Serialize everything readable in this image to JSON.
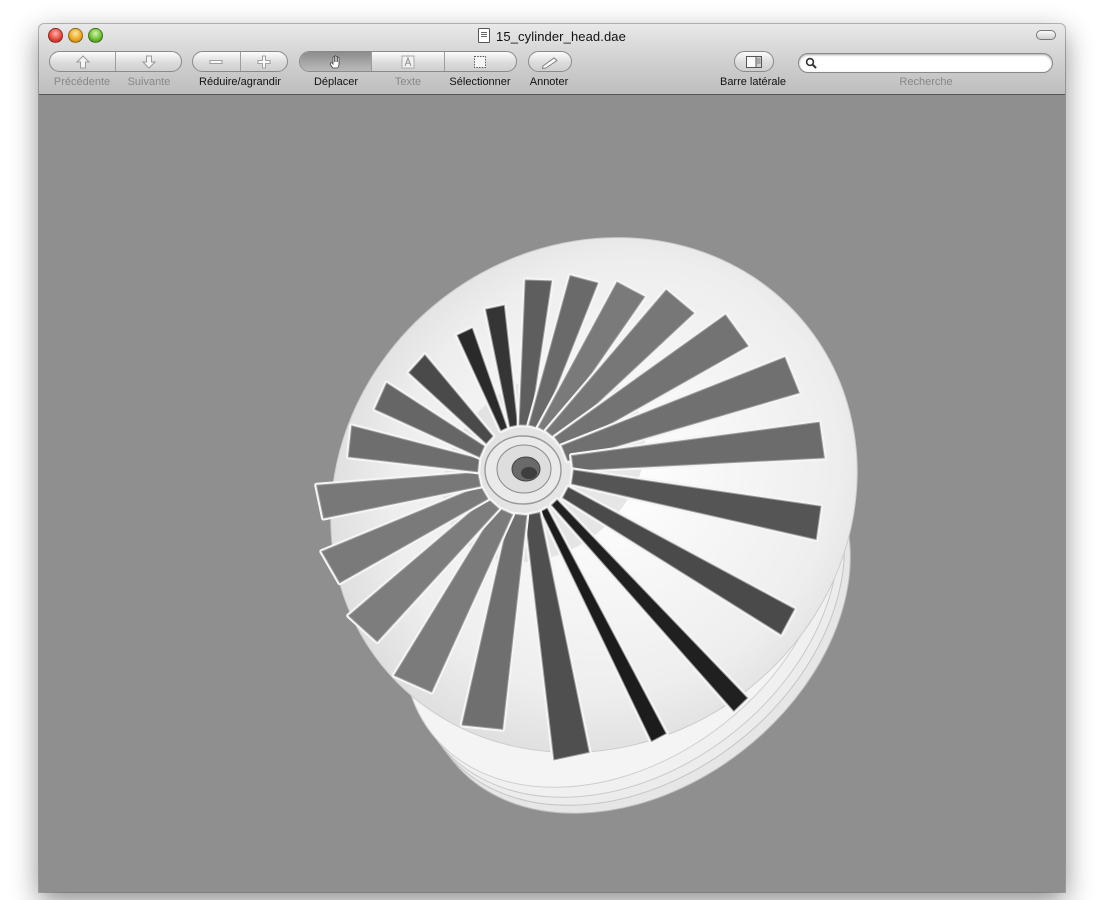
{
  "window": {
    "title": "15_cylinder_head.dae"
  },
  "toolbar": {
    "previous_label": "Précédente",
    "next_label": "Suivante",
    "zoom_label": "Réduire/agrandir",
    "move_label": "Déplacer",
    "text_label": "Texte",
    "select_label": "Sélectionner",
    "annotate_label": "Annoter",
    "sidebar_label": "Barre latérale",
    "search_label": "Recherche",
    "search_value": "",
    "search_placeholder": "",
    "active_tool": "Déplacer"
  },
  "icons": {
    "previous": "arrow-up-icon",
    "next": "arrow-down-icon",
    "zoom_out": "minus-icon",
    "zoom_in": "plus-icon",
    "move": "hand-icon",
    "text": "text-cursor-icon",
    "select": "marquee-icon",
    "annotate": "pencil-icon",
    "sidebar": "sidebar-icon",
    "search": "magnifier-icon"
  },
  "colors": {
    "canvas_background": "#8f8f8f",
    "traffic_red": "#e0433a",
    "traffic_yellow": "#e7a323",
    "traffic_green": "#67b832"
  },
  "viewer": {
    "content": "3D cylinder head model with radial cooling fins"
  }
}
